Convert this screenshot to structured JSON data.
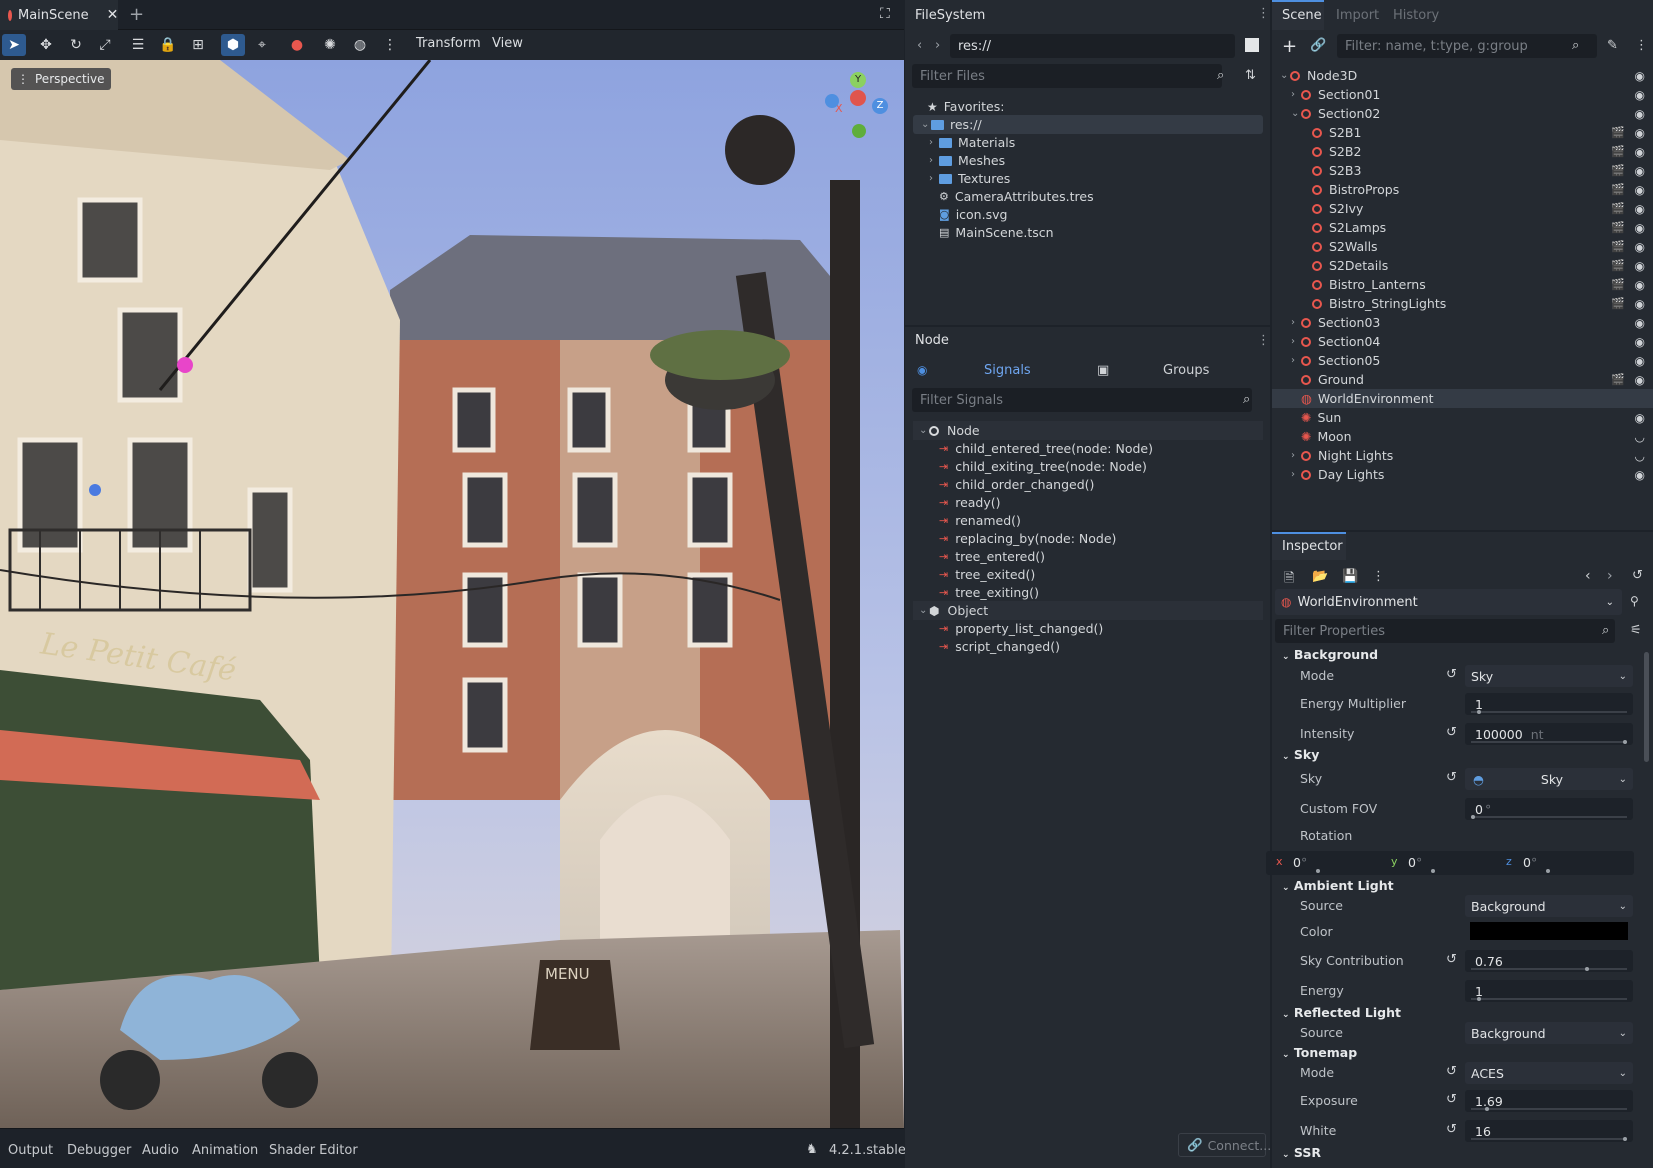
{
  "editor": {
    "scene_tab": "MainScene",
    "menus": {
      "transform": "Transform",
      "view": "View"
    },
    "perspective": "Perspective",
    "bottom_tabs": [
      "Output",
      "Debugger",
      "Audio",
      "Animation",
      "Shader Editor"
    ],
    "version": "4.2.1.stable",
    "gizmo": {
      "y": "Y",
      "x": "X",
      "z": "Z"
    },
    "scene_signs": {
      "cafe": "Le Petit Café",
      "menu": "MENU"
    }
  },
  "filesystem": {
    "title": "FileSystem",
    "path": "res://",
    "filter_placeholder": "Filter Files",
    "favorites": "Favorites:",
    "root": "res://",
    "items": [
      {
        "label": "Materials",
        "kind": "folder"
      },
      {
        "label": "Meshes",
        "kind": "folder"
      },
      {
        "label": "Textures",
        "kind": "folder"
      },
      {
        "label": "CameraAttributes.tres",
        "kind": "res"
      },
      {
        "label": "icon.svg",
        "kind": "img"
      },
      {
        "label": "MainScene.tscn",
        "kind": "scene"
      }
    ]
  },
  "node_panel": {
    "title": "Node",
    "tab_signals": "Signals",
    "tab_groups": "Groups",
    "filter_placeholder": "Filter Signals",
    "node_header": "Node",
    "node_signals": [
      "child_entered_tree(node: Node)",
      "child_exiting_tree(node: Node)",
      "child_order_changed()",
      "ready()",
      "renamed()",
      "replacing_by(node: Node)",
      "tree_entered()",
      "tree_exited()",
      "tree_exiting()"
    ],
    "object_header": "Object",
    "object_signals": [
      "property_list_changed()",
      "script_changed()"
    ],
    "connect": "Connect..."
  },
  "scene_panel": {
    "tabs": [
      "Scene",
      "Import",
      "History"
    ],
    "filter_placeholder": "Filter: name, t:type, g:group",
    "nodes": [
      {
        "label": "Node3D",
        "depth": 0,
        "arrow": "down",
        "clap": false,
        "eye": "on"
      },
      {
        "label": "Section01",
        "depth": 1,
        "arrow": "right",
        "clap": false,
        "eye": "on"
      },
      {
        "label": "Section02",
        "depth": 1,
        "arrow": "down",
        "clap": false,
        "eye": "on"
      },
      {
        "label": "S2B1",
        "depth": 2,
        "arrow": "",
        "clap": true,
        "eye": "on"
      },
      {
        "label": "S2B2",
        "depth": 2,
        "arrow": "",
        "clap": true,
        "eye": "on"
      },
      {
        "label": "S2B3",
        "depth": 2,
        "arrow": "",
        "clap": true,
        "eye": "on"
      },
      {
        "label": "BistroProps",
        "depth": 2,
        "arrow": "",
        "clap": true,
        "eye": "on"
      },
      {
        "label": "S2Ivy",
        "depth": 2,
        "arrow": "",
        "clap": true,
        "eye": "on"
      },
      {
        "label": "S2Lamps",
        "depth": 2,
        "arrow": "",
        "clap": true,
        "eye": "on"
      },
      {
        "label": "S2Walls",
        "depth": 2,
        "arrow": "",
        "clap": true,
        "eye": "on"
      },
      {
        "label": "S2Details",
        "depth": 2,
        "arrow": "",
        "clap": true,
        "eye": "on"
      },
      {
        "label": "Bistro_Lanterns",
        "depth": 2,
        "arrow": "",
        "clap": true,
        "eye": "on"
      },
      {
        "label": "Bistro_StringLights",
        "depth": 2,
        "arrow": "",
        "clap": true,
        "eye": "on"
      },
      {
        "label": "Section03",
        "depth": 1,
        "arrow": "right",
        "clap": false,
        "eye": "on"
      },
      {
        "label": "Section04",
        "depth": 1,
        "arrow": "right",
        "clap": false,
        "eye": "on"
      },
      {
        "label": "Section05",
        "depth": 1,
        "arrow": "right",
        "clap": false,
        "eye": "on"
      },
      {
        "label": "Ground",
        "depth": 1,
        "arrow": "",
        "clap": true,
        "eye": "on"
      },
      {
        "label": "WorldEnvironment",
        "depth": 1,
        "arrow": "",
        "clap": false,
        "eye": "",
        "selected": true,
        "kind": "globe"
      },
      {
        "label": "Sun",
        "depth": 1,
        "arrow": "",
        "clap": false,
        "eye": "on",
        "kind": "light"
      },
      {
        "label": "Moon",
        "depth": 1,
        "arrow": "",
        "clap": false,
        "eye": "off",
        "kind": "light"
      },
      {
        "label": "Night Lights",
        "depth": 1,
        "arrow": "right",
        "clap": false,
        "eye": "off"
      },
      {
        "label": "Day Lights",
        "depth": 1,
        "arrow": "right",
        "clap": false,
        "eye": "on"
      }
    ]
  },
  "inspector": {
    "title": "Inspector",
    "object": "WorldEnvironment",
    "filter_placeholder": "Filter Properties",
    "background": {
      "header": "Background",
      "mode_label": "Mode",
      "mode_value": "Sky",
      "energy_label": "Energy Multiplier",
      "energy_value": "1",
      "intensity_label": "Intensity",
      "intensity_value": "100000",
      "intensity_unit": "nt"
    },
    "sky": {
      "header": "Sky",
      "sky_label": "Sky",
      "sky_value": "Sky",
      "fov_label": "Custom FOV",
      "fov_value": "0",
      "rotation_label": "Rotation",
      "rot_x": "0",
      "rot_y": "0",
      "rot_z": "0",
      "deg": "°",
      "axis_x": "x",
      "axis_y": "y",
      "axis_z": "z"
    },
    "ambient": {
      "header": "Ambient Light",
      "source_label": "Source",
      "source_value": "Background",
      "color_label": "Color",
      "color_value": "#000000",
      "contrib_label": "Sky Contribution",
      "contrib_value": "0.76",
      "energy_label": "Energy",
      "energy_value": "1"
    },
    "reflected": {
      "header": "Reflected Light",
      "source_label": "Source",
      "source_value": "Background"
    },
    "tonemap": {
      "header": "Tonemap",
      "mode_label": "Mode",
      "mode_value": "ACES",
      "exposure_label": "Exposure",
      "exposure_value": "1.69",
      "white_label": "White",
      "white_value": "16"
    },
    "ssr": {
      "header": "SSR"
    }
  },
  "colors": {
    "accent": "#4e8fe0",
    "node_red": "#e8574e",
    "selected_row": "#343b45"
  }
}
